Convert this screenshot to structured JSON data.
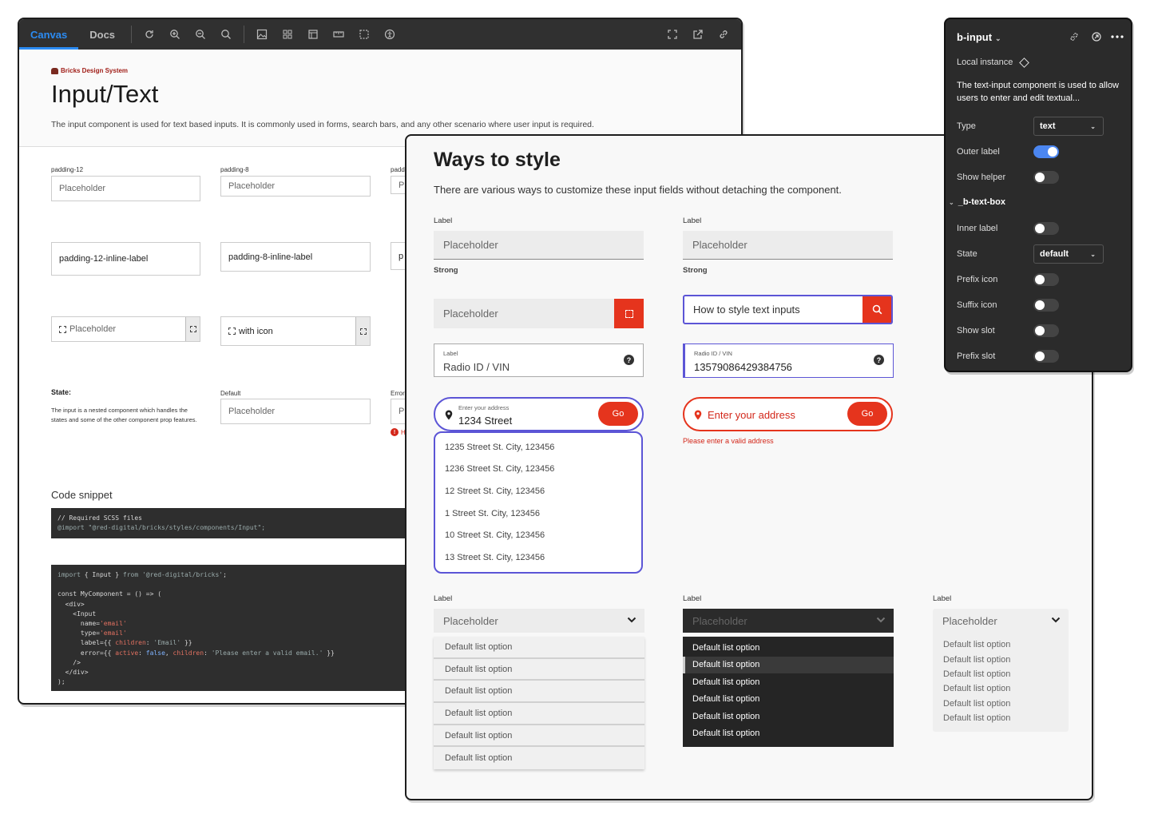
{
  "toolbar": {
    "tabs": [
      "Canvas",
      "Docs"
    ],
    "icons_left": [
      "refresh-icon",
      "zoom-in-icon",
      "zoom-out-icon",
      "zoom-reset-icon",
      "image-icon",
      "grid-icon",
      "layout-icon",
      "ruler-icon",
      "outline-icon",
      "accessibility-icon"
    ],
    "icons_right": [
      "fullscreen-icon",
      "open-new-icon",
      "link-icon"
    ],
    "accent": "#2b8bf2"
  },
  "storybook": {
    "brand": "Bricks Design System",
    "title": "Input/Text",
    "description": "The input component is used for text based inputs. It is commonly used in forms, search bars, and any other scenario where user input is required.",
    "col_labels": [
      "padding-12",
      "padding-8",
      "padd"
    ],
    "row1": [
      "Placeholder",
      "Placeholder",
      "Pl"
    ],
    "row2": [
      "padding-12-inline-label",
      "padding-8-inline-label",
      "p"
    ],
    "row3": [
      "Placeholder",
      "with icon"
    ],
    "state_heading": "State:",
    "state_desc": "The input is a nested component which handles the states and some of the other component prop features.",
    "state_labels": [
      "Default",
      "Error"
    ],
    "state_inputs": [
      "Placeholder",
      "Pl"
    ],
    "error_hint": "H",
    "code_title": "Code snippet",
    "code1_line1": "// Required SCSS files",
    "code1_line2": "@import \"@red-digital/bricks/styles/components/Input\";",
    "code2": {
      "l1_kw": "import",
      "l1_a": " { Input } ",
      "l1_from": "from",
      "l1_s": " '@red-digital/bricks'",
      "l1_end": ";",
      "l2": "const MyComponent = () => (",
      "l3": "  <div>",
      "l4": "    <Input",
      "l5_attr": "      name=",
      "l5_val": "'email'",
      "l6_attr": "      type=",
      "l6_val": "'email'",
      "l7_attr": "      label={{ ",
      "l7_key": "children",
      "l7_colon": ": ",
      "l7_val": "'Email'",
      "l7_end": " }}",
      "l8_attr": "      error={{ ",
      "l8_key1": "active",
      "l8_colon1": ": ",
      "l8_v1": "false",
      "l8_comma": ", ",
      "l8_key2": "children",
      "l8_colon2": ": ",
      "l8_v2": "'Please enter a valid email.'",
      "l8_end": " }}",
      "l9": "    />",
      "l10": "  </div>",
      "l11": ");"
    }
  },
  "ways": {
    "title": "Ways to style",
    "description": "There are various ways to customize these input fields without detaching the component.",
    "label": "Label",
    "strong": "Strong",
    "placeholder": "Placeholder",
    "search_value": "How to style text inputs",
    "vin_label_1": "Label",
    "vin_value_1": "Radio ID / VIN",
    "vin_label_2": "Radio ID / VIN",
    "vin_value_2": "13579086429384756",
    "help_glyph": "?",
    "address_label": "Enter your address",
    "address_value": "1234 Street",
    "address_placeholder": "Enter your address",
    "go": "Go",
    "address_error": "Please enter a valid address",
    "address_options": [
      "1235 Street St. City, 123456",
      "1236 Street St. City, 123456",
      "12 Street St. City, 123456",
      "1 Street St. City, 123456",
      "10 Street St. City, 123456",
      "13 Street St. City, 123456"
    ],
    "list_option": "Default list option",
    "accent": "#5c55d6",
    "brand_red": "#e5341d"
  },
  "panel": {
    "title": "b-input",
    "caret": "⌄",
    "local_instance": "Local instance",
    "description": "The text-input component is used to allow users to enter and edit textual...",
    "type_label": "Type",
    "type_value": "text",
    "outer_label": "Outer label",
    "show_helper": "Show helper",
    "section": "_b-text-box",
    "inner_label": "Inner label",
    "state_label": "State",
    "state_value": "default",
    "prefix_icon": "Prefix icon",
    "suffix_icon": "Suffix icon",
    "show_slot": "Show slot",
    "prefix_slot": "Prefix slot",
    "toggles": {
      "outer_label": true,
      "show_helper": false,
      "inner_label": false,
      "prefix_icon": false,
      "suffix_icon": false,
      "show_slot": false,
      "prefix_slot": false
    },
    "toggle_on_color": "#4b86f0"
  }
}
